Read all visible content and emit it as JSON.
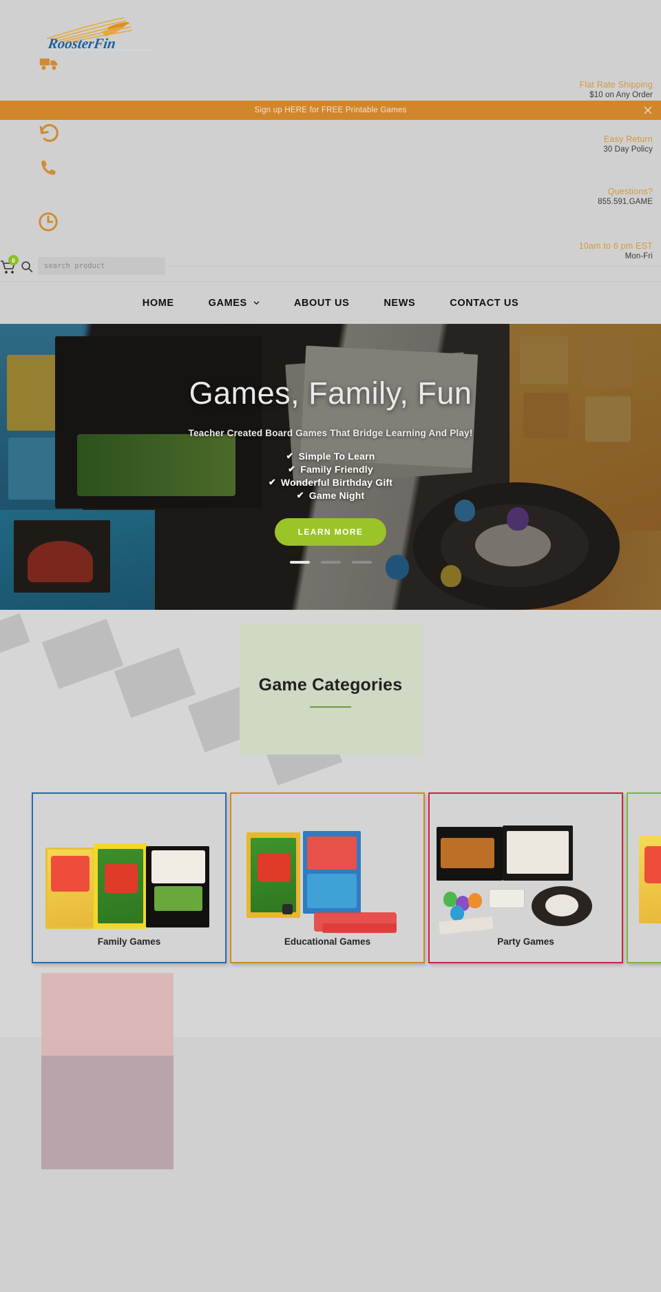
{
  "brand": {
    "name": "RoosterFin",
    "logo_icon": "roosterfin-logo"
  },
  "announcement": {
    "text": "Sign up HERE for FREE Printable Games",
    "close_icon": "close-icon",
    "bg": "#d1862c"
  },
  "utility": [
    {
      "icon": "truck-icon",
      "title": "Flat Rate Shipping",
      "sub": "$10 on Any Order"
    },
    {
      "icon": "return-icon",
      "title": "Easy Return",
      "sub": "30 Day Policy"
    },
    {
      "icon": "phone-icon",
      "title": "Questions?",
      "sub": "855.591.GAME"
    },
    {
      "icon": "clock-icon",
      "title": "10am to 6 pm EST",
      "sub": "Mon-Fri"
    }
  ],
  "search": {
    "placeholder": "search product",
    "value": "",
    "icon": "search-icon"
  },
  "cart": {
    "icon": "cart-icon",
    "count": "0",
    "badge_color": "#8cbf26"
  },
  "nav": [
    {
      "label": "HOME",
      "has_caret": false
    },
    {
      "label": "GAMES",
      "has_caret": true
    },
    {
      "label": "ABOUT US",
      "has_caret": false
    },
    {
      "label": "NEWS",
      "has_caret": false
    },
    {
      "label": "CONTACT US",
      "has_caret": false
    }
  ],
  "hero": {
    "title": "Games, Family, Fun",
    "subtitle": "Teacher Created Board Games That Bridge Learning And Play!",
    "bullets": [
      "Simple To Learn",
      "Family Friendly",
      "Wonderful Birthday Gift",
      "Game Night"
    ],
    "tick": "✔",
    "cta_label": "LEARN MORE",
    "cta_color": "#9ac428",
    "slides": 3,
    "active_slide": 1
  },
  "categories": {
    "heading": "Game Categories",
    "accent": "#6f9a3a",
    "cards": [
      {
        "label": "Family Games",
        "border": "#2a6aa8"
      },
      {
        "label": "Educational Games",
        "border": "#d08627"
      },
      {
        "label": "Party Games",
        "border": "#cc2046"
      },
      {
        "label": "",
        "border": "#77b83f"
      }
    ]
  }
}
